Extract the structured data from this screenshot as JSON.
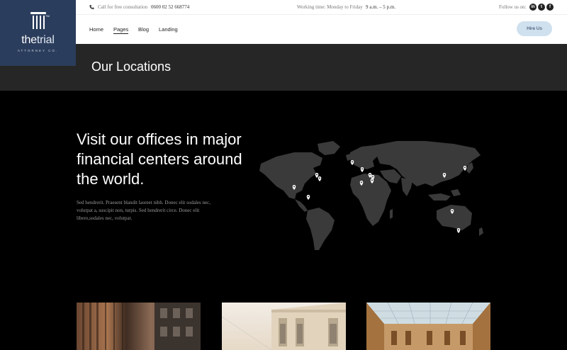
{
  "brand": {
    "name_a": "the",
    "name_b": "trial",
    "sub": "ATTORNEY CO.",
    "tm": "TM"
  },
  "topbar": {
    "call_label": "Call for free consultation",
    "phone": "0600 02 52 668774",
    "hours_label": "Working time: Monday to Friday",
    "hours_value": "9 a.m. – 5 p.m.",
    "follow_label": "Follow us on:",
    "social": [
      {
        "icon": "linkedin-icon",
        "glyph": "in"
      },
      {
        "icon": "twitter-icon",
        "glyph": "t"
      },
      {
        "icon": "facebook-icon",
        "glyph": "f"
      }
    ]
  },
  "nav": {
    "items": [
      {
        "label": "Home",
        "active": false
      },
      {
        "label": "Pages",
        "active": true
      },
      {
        "label": "Blog",
        "active": false
      },
      {
        "label": "Landing",
        "active": false
      }
    ],
    "cta": "Hire Us"
  },
  "page_title": "Our Locations",
  "section": {
    "headline": "Visit our offices in major financial centers around the world.",
    "body": "Sed hendrerit. Praesent blandit laoreet nibh. Donec elit sodales nec, volutpat a, suscipit non, turpis. Sed hendrerit circe. Donec elit libero,sodales nec, volutpat."
  },
  "colors": {
    "brand_navy": "#2b3d5c",
    "cta_bg": "#cfe0ee",
    "title_band": "#262626",
    "map_land": "#3a3a3a",
    "pin": "#ffffff"
  },
  "map_pins": [
    {
      "name": "map-pin-seattle"
    },
    {
      "name": "map-pin-chicago"
    },
    {
      "name": "map-pin-new-york"
    },
    {
      "name": "map-pin-los-angeles"
    },
    {
      "name": "map-pin-mexico"
    },
    {
      "name": "map-pin-london"
    },
    {
      "name": "map-pin-berlin"
    },
    {
      "name": "map-pin-rome"
    },
    {
      "name": "map-pin-cairo"
    },
    {
      "name": "map-pin-dubai"
    },
    {
      "name": "map-pin-beijing"
    },
    {
      "name": "map-pin-tokyo"
    },
    {
      "name": "map-pin-jakarta"
    },
    {
      "name": "map-pin-sydney"
    }
  ],
  "photos": [
    {
      "name": "office-photo-1"
    },
    {
      "name": "office-photo-2"
    },
    {
      "name": "office-photo-3"
    }
  ]
}
